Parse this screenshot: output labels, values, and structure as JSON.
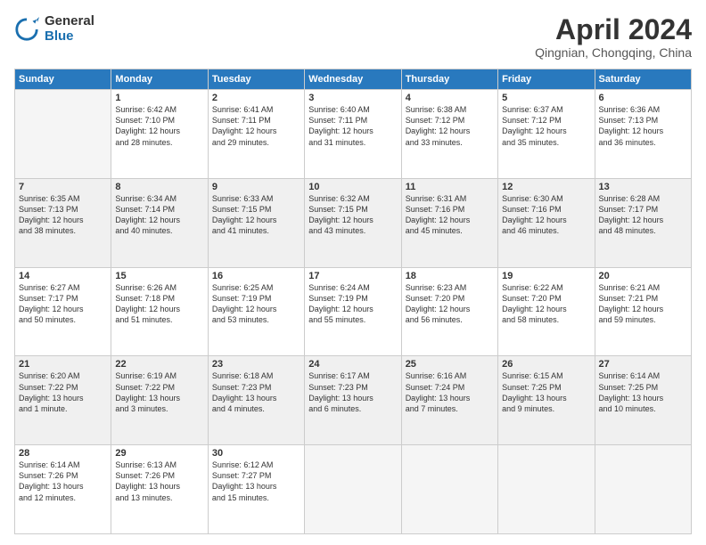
{
  "logo": {
    "general": "General",
    "blue": "Blue"
  },
  "header": {
    "month": "April 2024",
    "location": "Qingnian, Chongqing, China"
  },
  "weekdays": [
    "Sunday",
    "Monday",
    "Tuesday",
    "Wednesday",
    "Thursday",
    "Friday",
    "Saturday"
  ],
  "weeks": [
    [
      {
        "num": "",
        "info": ""
      },
      {
        "num": "1",
        "info": "Sunrise: 6:42 AM\nSunset: 7:10 PM\nDaylight: 12 hours\nand 28 minutes."
      },
      {
        "num": "2",
        "info": "Sunrise: 6:41 AM\nSunset: 7:11 PM\nDaylight: 12 hours\nand 29 minutes."
      },
      {
        "num": "3",
        "info": "Sunrise: 6:40 AM\nSunset: 7:11 PM\nDaylight: 12 hours\nand 31 minutes."
      },
      {
        "num": "4",
        "info": "Sunrise: 6:38 AM\nSunset: 7:12 PM\nDaylight: 12 hours\nand 33 minutes."
      },
      {
        "num": "5",
        "info": "Sunrise: 6:37 AM\nSunset: 7:12 PM\nDaylight: 12 hours\nand 35 minutes."
      },
      {
        "num": "6",
        "info": "Sunrise: 6:36 AM\nSunset: 7:13 PM\nDaylight: 12 hours\nand 36 minutes."
      }
    ],
    [
      {
        "num": "7",
        "info": "Sunrise: 6:35 AM\nSunset: 7:13 PM\nDaylight: 12 hours\nand 38 minutes."
      },
      {
        "num": "8",
        "info": "Sunrise: 6:34 AM\nSunset: 7:14 PM\nDaylight: 12 hours\nand 40 minutes."
      },
      {
        "num": "9",
        "info": "Sunrise: 6:33 AM\nSunset: 7:15 PM\nDaylight: 12 hours\nand 41 minutes."
      },
      {
        "num": "10",
        "info": "Sunrise: 6:32 AM\nSunset: 7:15 PM\nDaylight: 12 hours\nand 43 minutes."
      },
      {
        "num": "11",
        "info": "Sunrise: 6:31 AM\nSunset: 7:16 PM\nDaylight: 12 hours\nand 45 minutes."
      },
      {
        "num": "12",
        "info": "Sunrise: 6:30 AM\nSunset: 7:16 PM\nDaylight: 12 hours\nand 46 minutes."
      },
      {
        "num": "13",
        "info": "Sunrise: 6:28 AM\nSunset: 7:17 PM\nDaylight: 12 hours\nand 48 minutes."
      }
    ],
    [
      {
        "num": "14",
        "info": "Sunrise: 6:27 AM\nSunset: 7:17 PM\nDaylight: 12 hours\nand 50 minutes."
      },
      {
        "num": "15",
        "info": "Sunrise: 6:26 AM\nSunset: 7:18 PM\nDaylight: 12 hours\nand 51 minutes."
      },
      {
        "num": "16",
        "info": "Sunrise: 6:25 AM\nSunset: 7:19 PM\nDaylight: 12 hours\nand 53 minutes."
      },
      {
        "num": "17",
        "info": "Sunrise: 6:24 AM\nSunset: 7:19 PM\nDaylight: 12 hours\nand 55 minutes."
      },
      {
        "num": "18",
        "info": "Sunrise: 6:23 AM\nSunset: 7:20 PM\nDaylight: 12 hours\nand 56 minutes."
      },
      {
        "num": "19",
        "info": "Sunrise: 6:22 AM\nSunset: 7:20 PM\nDaylight: 12 hours\nand 58 minutes."
      },
      {
        "num": "20",
        "info": "Sunrise: 6:21 AM\nSunset: 7:21 PM\nDaylight: 12 hours\nand 59 minutes."
      }
    ],
    [
      {
        "num": "21",
        "info": "Sunrise: 6:20 AM\nSunset: 7:22 PM\nDaylight: 13 hours\nand 1 minute."
      },
      {
        "num": "22",
        "info": "Sunrise: 6:19 AM\nSunset: 7:22 PM\nDaylight: 13 hours\nand 3 minutes."
      },
      {
        "num": "23",
        "info": "Sunrise: 6:18 AM\nSunset: 7:23 PM\nDaylight: 13 hours\nand 4 minutes."
      },
      {
        "num": "24",
        "info": "Sunrise: 6:17 AM\nSunset: 7:23 PM\nDaylight: 13 hours\nand 6 minutes."
      },
      {
        "num": "25",
        "info": "Sunrise: 6:16 AM\nSunset: 7:24 PM\nDaylight: 13 hours\nand 7 minutes."
      },
      {
        "num": "26",
        "info": "Sunrise: 6:15 AM\nSunset: 7:25 PM\nDaylight: 13 hours\nand 9 minutes."
      },
      {
        "num": "27",
        "info": "Sunrise: 6:14 AM\nSunset: 7:25 PM\nDaylight: 13 hours\nand 10 minutes."
      }
    ],
    [
      {
        "num": "28",
        "info": "Sunrise: 6:14 AM\nSunset: 7:26 PM\nDaylight: 13 hours\nand 12 minutes."
      },
      {
        "num": "29",
        "info": "Sunrise: 6:13 AM\nSunset: 7:26 PM\nDaylight: 13 hours\nand 13 minutes."
      },
      {
        "num": "30",
        "info": "Sunrise: 6:12 AM\nSunset: 7:27 PM\nDaylight: 13 hours\nand 15 minutes."
      },
      {
        "num": "",
        "info": ""
      },
      {
        "num": "",
        "info": ""
      },
      {
        "num": "",
        "info": ""
      },
      {
        "num": "",
        "info": ""
      }
    ]
  ]
}
